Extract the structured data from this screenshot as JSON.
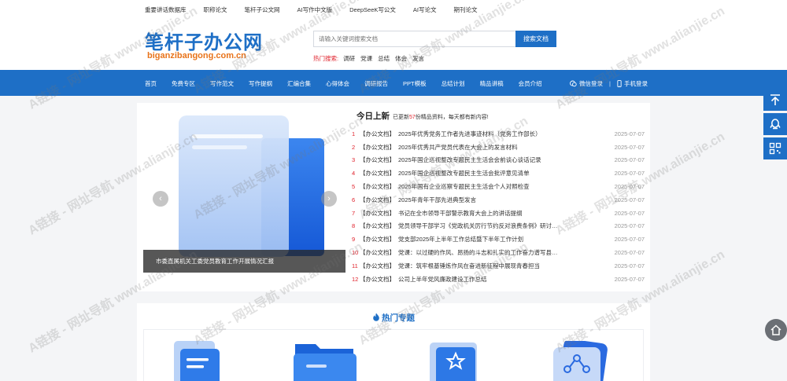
{
  "topbar": {
    "links": [
      "重要讲话数据库",
      "职称论文",
      "笔杆子公文网",
      "AI写作中文版",
      "DeepSeeK写公文",
      "AI写论文",
      "期刊论文"
    ]
  },
  "header": {
    "logo_main": "笔杆子办公网",
    "logo_sub": "biganzibangong.com.cn",
    "search_placeholder": "请输入关键词搜索文档",
    "search_button": "搜索文档",
    "hot_label": "热门搜索:",
    "hot_items": [
      "调研",
      "党课",
      "总结",
      "体会",
      "发言"
    ]
  },
  "nav": {
    "items": [
      "首页",
      "免费专区",
      "写作范文",
      "写作提纲",
      "汇编合集",
      "心得体会",
      "调研报告",
      "PPT模板",
      "总结计划",
      "精品讲稿",
      "会员介绍"
    ],
    "wechat_login": "微信登录",
    "separator": "|",
    "phone_login": "手机登录"
  },
  "slider": {
    "caption": "市委直属机关工委党员教育工作开展情况汇报",
    "prev": "‹",
    "next": "›"
  },
  "today": {
    "title": "今日上新",
    "sub_prefix": "已更新",
    "count": "57",
    "sub_suffix": "份精品资料，每天都有新内容!",
    "rows": [
      {
        "num": "1",
        "cat": "【办公文档】",
        "title": "2025年优秀党务工作者先进事迹材料（党务工作部长）",
        "date": "2025-07-07"
      },
      {
        "num": "2",
        "cat": "【办公文档】",
        "title": "2025年优秀共产党员代表在大会上的发言材料",
        "date": "2025-07-07"
      },
      {
        "num": "3",
        "cat": "【办公文档】",
        "title": "2025年国企巡视整改专题民主生活会会前谈心谈话记录",
        "date": "2025-07-07"
      },
      {
        "num": "4",
        "cat": "【办公文档】",
        "title": "2025年国企巡视整改专题民主生活会批评意见清单",
        "date": "2025-07-07"
      },
      {
        "num": "5",
        "cat": "【办公文档】",
        "title": "2025年国有企业巡察专题民主生活会个人对照检查",
        "date": "2025-07-07"
      },
      {
        "num": "6",
        "cat": "【办公文档】",
        "title": "2025年青年干部先进典型发言",
        "date": "2025-07-07"
      },
      {
        "num": "7",
        "cat": "【办公文档】",
        "title": "书记在全市领导干部警示教育大会上的讲话提纲",
        "date": "2025-07-07"
      },
      {
        "num": "8",
        "cat": "【办公文档】",
        "title": "党员领导干部学习《党政机关厉行节约反对浪费条例》研讨…",
        "date": "2025-07-07"
      },
      {
        "num": "9",
        "cat": "【办公文档】",
        "title": "党支部2025年上半年工作总结暨下半年工作计划",
        "date": "2025-07-07"
      },
      {
        "num": "10",
        "cat": "【办公文档】",
        "title": "党课：以过硬的作风、昂扬的斗志和扎实的工作奋力谱写县…",
        "date": "2025-07-07"
      },
      {
        "num": "11",
        "cat": "【办公文档】",
        "title": "党课：筑牢根基锤炼作风在奋进新征程中展现青春担当",
        "date": "2025-07-07"
      },
      {
        "num": "12",
        "cat": "【办公文档】",
        "title": "公司上半年党风廉政建设工作总结",
        "date": "2025-07-07"
      }
    ]
  },
  "hot_topics": {
    "title": "热门专题"
  },
  "watermark": "A链接 - 网址导航 www.alianjie.cn",
  "colors": {
    "brand": "#1e6fc6",
    "accent_red": "#e0222c",
    "logo_orange": "#e8731a"
  }
}
